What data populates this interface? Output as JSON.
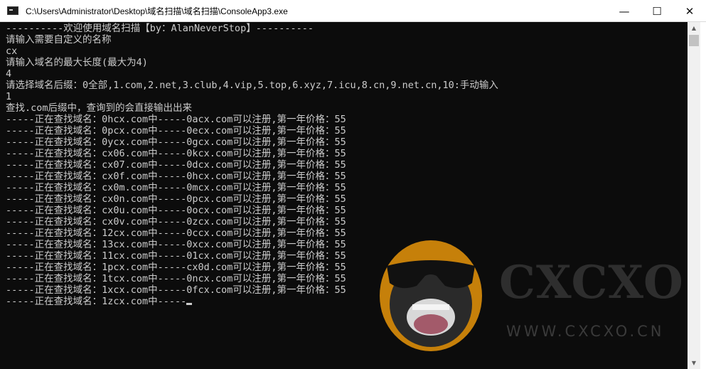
{
  "window": {
    "title": "C:\\Users\\Administrator\\Desktop\\域名扫描\\域名扫描\\ConsoleApp3.exe",
    "minimize": "—",
    "maximize": "☐",
    "close": "✕"
  },
  "console": {
    "lines": [
      "----------欢迎使用域名扫描【by：AlanNeverStop】----------",
      "请输入需要自定义的名称",
      "cx",
      "请输入域名的最大长度(最大为4)",
      "4",
      "请选择域名后缀：0全部,1.com,2.net,3.club,4.vip,5.top,6.xyz,7.icu,8.cn,9.net.cn,10:手动输入",
      "1",
      "查找.com后缀中，查询到的会直接输出出来",
      "-----正在查找域名：0hcx.com中-----0acx.com可以注册,第一年价格：55",
      "-----正在查找域名：0pcx.com中-----0ecx.com可以注册,第一年价格：55",
      "-----正在查找域名：0ycx.com中-----0gcx.com可以注册,第一年价格：55",
      "-----正在查找域名：cx06.com中-----0kcx.com可以注册,第一年价格：55",
      "-----正在查找域名：cx07.com中-----0dcx.com可以注册,第一年价格：55",
      "-----正在查找域名：cx0f.com中-----0hcx.com可以注册,第一年价格：55",
      "-----正在查找域名：cx0m.com中-----0mcx.com可以注册,第一年价格：55",
      "-----正在查找域名：cx0n.com中-----0pcx.com可以注册,第一年价格：55",
      "-----正在查找域名：cx0u.com中-----0ocx.com可以注册,第一年价格：55",
      "-----正在查找域名：cx0v.com中-----0zcx.com可以注册,第一年价格：55",
      "-----正在查找域名：12cx.com中-----0ccx.com可以注册,第一年价格：55",
      "-----正在查找域名：13cx.com中-----0xcx.com可以注册,第一年价格：55",
      "-----正在查找域名：11cx.com中-----01cx.com可以注册,第一年价格：55",
      "-----正在查找域名：1pcx.com中-----cx0d.com可以注册,第一年价格：55",
      "-----正在查找域名：1tcx.com中-----0ncx.com可以注册,第一年价格：55",
      "-----正在查找域名：1xcx.com中-----0fcx.com可以注册,第一年价格：55"
    ],
    "last_line": "-----正在查找域名：1zcx.com中-----"
  },
  "watermark": {
    "brand": "CXCXO",
    "url": "WWW.CXCXO.CN"
  },
  "colors": {
    "console_bg": "#0c0c0c",
    "console_text": "#cccccc",
    "mascot_orange": "#e8950a"
  },
  "scrollbar": {
    "up_arrow": "▲",
    "down_arrow": "▼"
  }
}
